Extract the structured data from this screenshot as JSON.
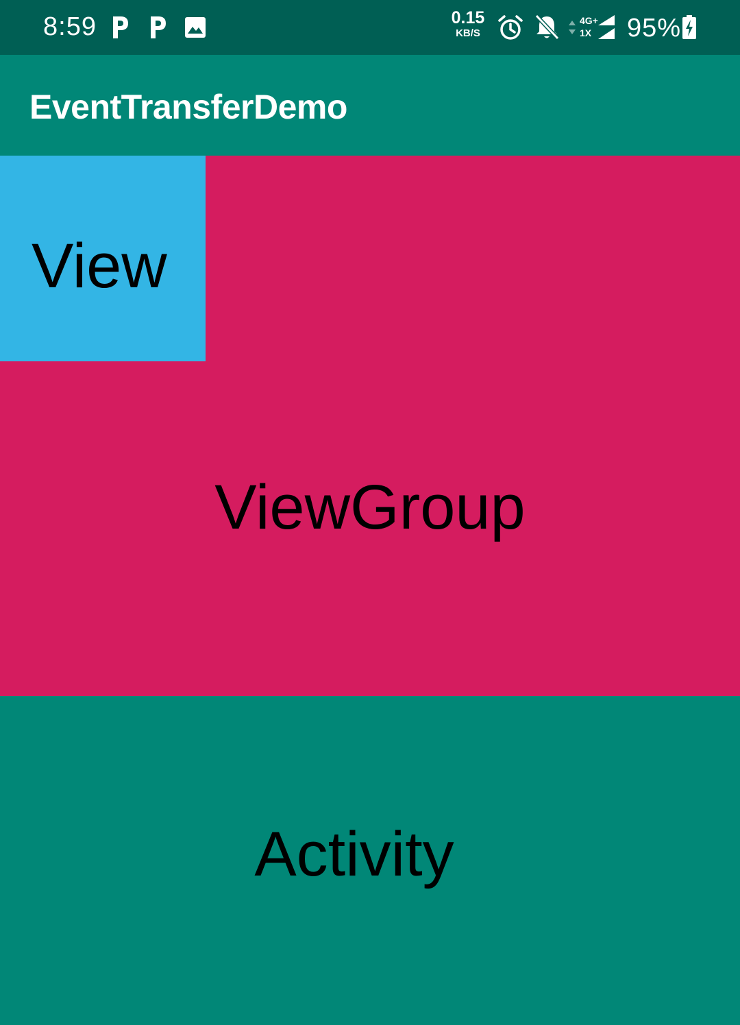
{
  "colors": {
    "status_bar": "#005f54",
    "app_bar": "#018777",
    "activity_bg": "#018777",
    "viewgroup_bg": "#d51c5f",
    "view_bg": "#33b5e5",
    "text_dark": "#000000",
    "text_light": "#ffffff"
  },
  "status_bar": {
    "time": "8:59",
    "notification_icons": [
      "parking-app-icon",
      "parking-app-icon",
      "image-icon"
    ],
    "net_speed_value": "0.15",
    "net_speed_unit": "KB/S",
    "network_type_top": "4G+",
    "network_type_bottom": "1X",
    "battery_percent": "95%"
  },
  "app_bar": {
    "title": "EventTransferDemo"
  },
  "content": {
    "view_label": "View",
    "viewgroup_label": "ViewGroup",
    "activity_label": "Activity"
  }
}
